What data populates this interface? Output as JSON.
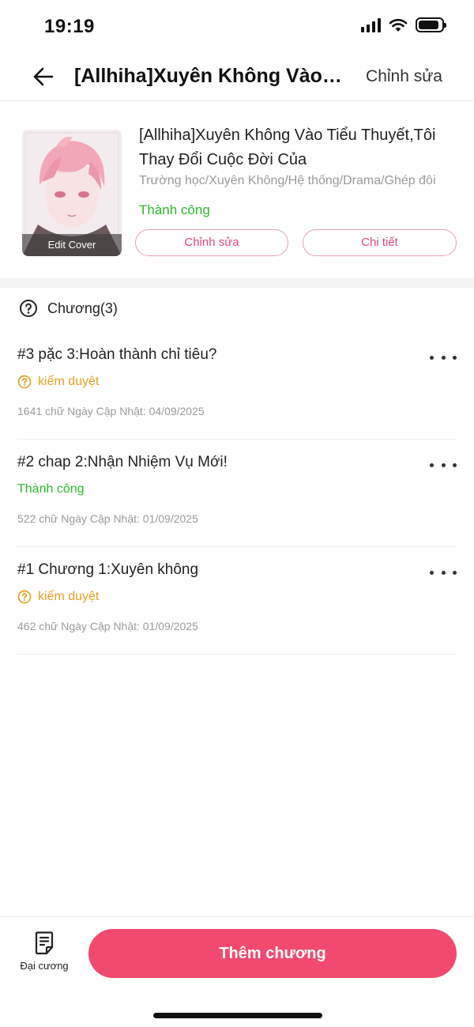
{
  "status_bar": {
    "time": "19:19",
    "battery_level": 0.9
  },
  "nav": {
    "back_icon": "arrow-left-icon",
    "title": "[Allhiha]Xuyên Không Vào Tiểu Thuyết,Tôi Thay Đổi Cuộc Đời Của",
    "edit_label": "Chỉnh sửa"
  },
  "story": {
    "cover_caption": "Edit Cover",
    "title": "[Allhiha]Xuyên Không Vào Tiểu Thuyết,Tôi Thay Đổi Cuộc Đời Của",
    "tags": "Trường học/Xuyên Không/Hệ thống/Drama/Ghép đôi",
    "status": "Thành công",
    "edit_button": "Chỉnh sửa",
    "detail_button": "Chi tiết"
  },
  "chapters": {
    "header": "Chương(3)",
    "items": [
      {
        "title": "#3 pặc 3:Hoàn thành chỉ tiêu?",
        "status": "kiểm duyệt",
        "status_type": "review",
        "meta": "1641 chữ Ngày Cập Nhật: 04/09/2025"
      },
      {
        "title": "#2 chap 2:Nhận Nhiệm Vụ Mới!",
        "status": "Thành công",
        "status_type": "ok",
        "meta": "522 chữ Ngày Cập Nhật: 01/09/2025"
      },
      {
        "title": "#1 Chương 1:Xuyên không",
        "status": "kiểm duyệt",
        "status_type": "review",
        "meta": "462 chữ Ngày Cập Nhật: 01/09/2025"
      }
    ]
  },
  "bottom": {
    "outline_label": "Đại cương",
    "add_chapter_label": "Thêm chương"
  },
  "colors": {
    "accent": "#f24a6e",
    "success": "#2db82d",
    "review": "#e8a020",
    "pill_text": "#e0487a"
  }
}
